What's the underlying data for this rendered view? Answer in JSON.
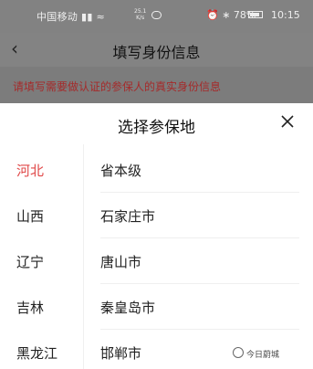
{
  "status_bar": {
    "carrier": "中国移动",
    "net_speed_value": "25.1",
    "net_speed_unit": "K/s",
    "battery": "78%",
    "time": "10:15"
  },
  "header": {
    "title": "填写身份信息"
  },
  "hint": {
    "text": "请填写需要做认证的参保人的真实身份信息"
  },
  "picker": {
    "title": "选择参保地",
    "provinces": [
      {
        "label": "河北",
        "selected": true
      },
      {
        "label": "山西",
        "selected": false
      },
      {
        "label": "辽宁",
        "selected": false
      },
      {
        "label": "吉林",
        "selected": false
      },
      {
        "label": "黑龙江",
        "selected": false
      }
    ],
    "cities": [
      "省本级",
      "石家庄市",
      "唐山市",
      "秦皇岛市",
      "邯郸市"
    ]
  },
  "watermark": "今日蔚城",
  "colors": {
    "accent": "#e04848",
    "hint_text": "#a52a2a",
    "overlay": "#808080"
  }
}
